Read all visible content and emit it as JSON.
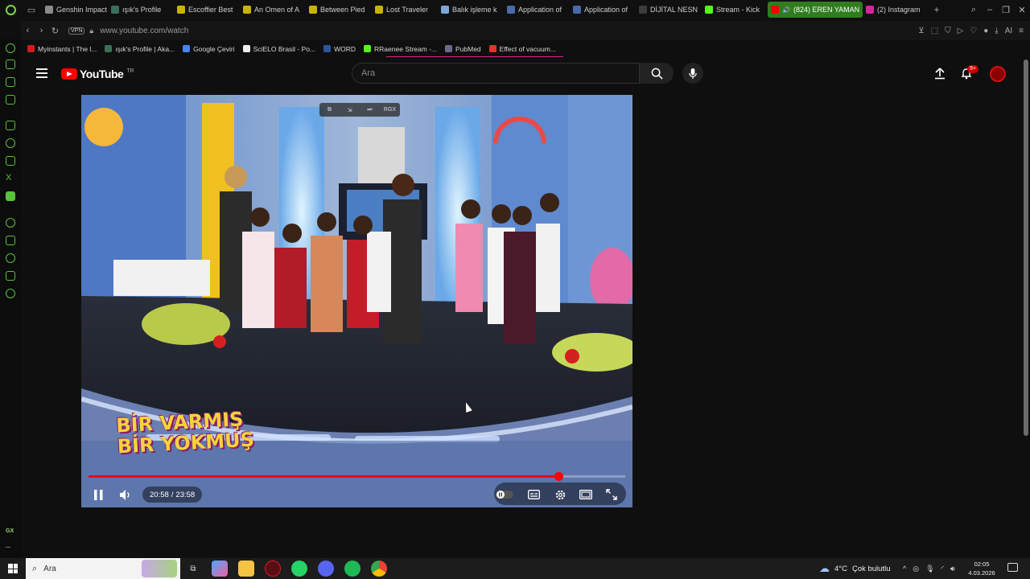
{
  "tabs": [
    {
      "label": "Genshin Impact",
      "color": "#8a8a8a"
    },
    {
      "label": "ışık's Profile",
      "color": "#3a6f5a"
    },
    {
      "label": "Escoffier Best",
      "color": "#c8b400"
    },
    {
      "label": "An Omen of A",
      "color": "#c8b400"
    },
    {
      "label": "Between Pied",
      "color": "#c8b400"
    },
    {
      "label": "Lost Traveler",
      "color": "#c8b400"
    },
    {
      "label": "Balık işleme k",
      "color": "#7aa7d8"
    },
    {
      "label": "Application of",
      "color": "#4a6aa8"
    },
    {
      "label": "Application of",
      "color": "#4a6aa8"
    },
    {
      "label": "DİJİTAL NESN",
      "color": "#3c3c3c"
    },
    {
      "label": "Stream - Kick",
      "color": "#53fc18"
    }
  ],
  "active_tab": {
    "label": "(824) EREN YAMAN",
    "color": "#ff0000"
  },
  "extra_tab": {
    "label": "(2) Instagram",
    "color": "#d6249f"
  },
  "address": {
    "vpn_label": "VPN",
    "url": "www.youtube.com/watch",
    "ai_label": "AI"
  },
  "bookmarks": [
    {
      "label": "Myinstants | The l...",
      "color": "#d01c1c"
    },
    {
      "label": "ışık's Profile | Aka...",
      "color": "#3a6f5a"
    },
    {
      "label": "Google Çeviri",
      "color": "#4285f4"
    },
    {
      "label": "SciELO Brasil - Po...",
      "color": "#eeeeee"
    },
    {
      "label": "WORD",
      "color": "#2b579a"
    },
    {
      "label": "RRaenee Stream -...",
      "color": "#53fc18"
    },
    {
      "label": "PubMed",
      "color": "#6a6a8a"
    },
    {
      "label": "Effect of vacuum...",
      "color": "#e0342c"
    }
  ],
  "sidebar": {
    "gx_label": "GX",
    "more_label": "..."
  },
  "youtube": {
    "logo_text": "YouTube",
    "region": "TR",
    "search_placeholder": "Ara",
    "notification_count": "9+"
  },
  "video": {
    "overlay_title_line1": "BİR VARMIŞ",
    "overlay_title_line2": "BİR YOKMUŞ",
    "pip_labels": [
      "⧉",
      "⇲",
      "⏭",
      "RGX"
    ],
    "current_time": "20:58",
    "separator": "/",
    "duration": "23:58",
    "progress_fraction": 0.875
  },
  "taskbar": {
    "search_placeholder": "Ara",
    "temperature": "4°C",
    "weather": "Çok bulutlu",
    "time": "02:05",
    "date": "4.03.2026"
  }
}
